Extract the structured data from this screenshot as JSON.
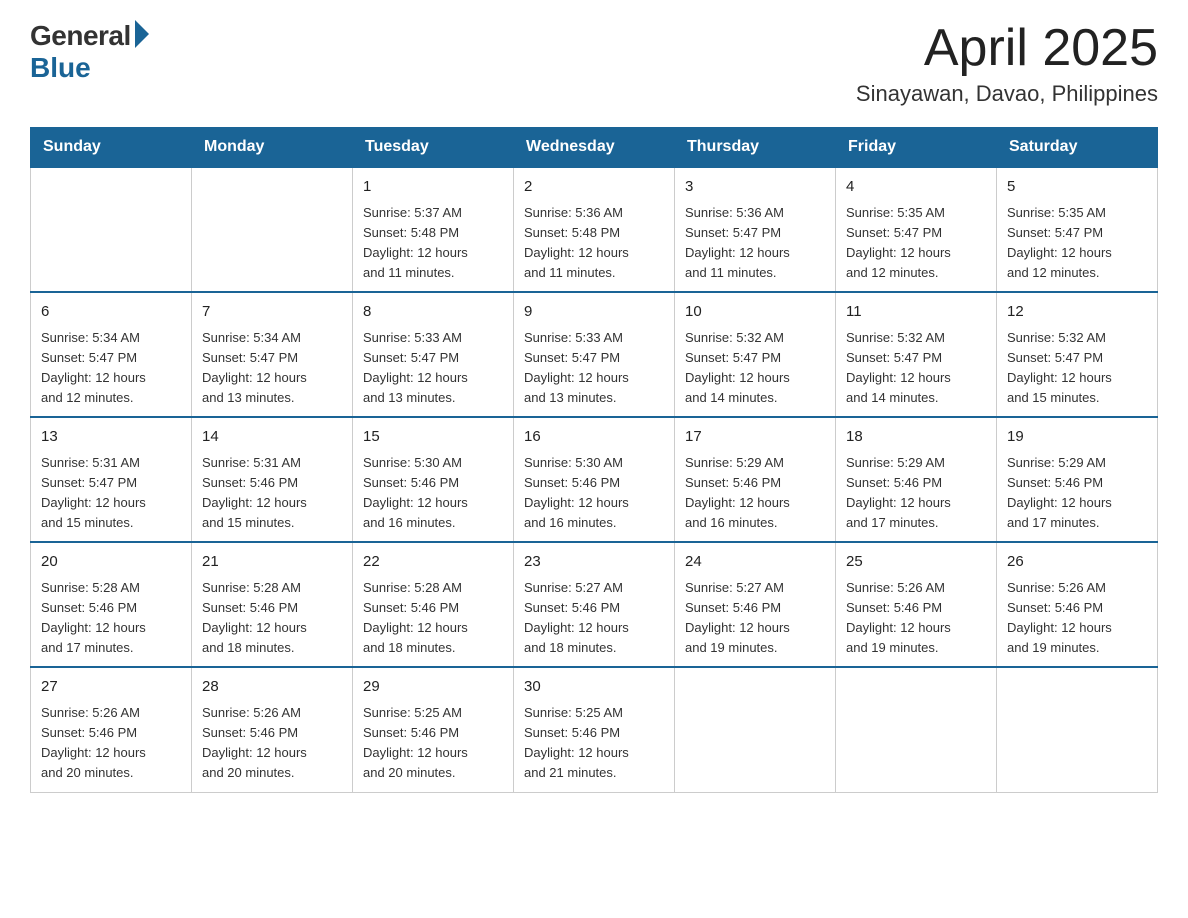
{
  "logo": {
    "general": "General",
    "blue": "Blue"
  },
  "title": {
    "month_year": "April 2025",
    "location": "Sinayawan, Davao, Philippines"
  },
  "weekdays": [
    "Sunday",
    "Monday",
    "Tuesday",
    "Wednesday",
    "Thursday",
    "Friday",
    "Saturday"
  ],
  "weeks": [
    [
      {
        "day": "",
        "info": ""
      },
      {
        "day": "",
        "info": ""
      },
      {
        "day": "1",
        "info": "Sunrise: 5:37 AM\nSunset: 5:48 PM\nDaylight: 12 hours\nand 11 minutes."
      },
      {
        "day": "2",
        "info": "Sunrise: 5:36 AM\nSunset: 5:48 PM\nDaylight: 12 hours\nand 11 minutes."
      },
      {
        "day": "3",
        "info": "Sunrise: 5:36 AM\nSunset: 5:47 PM\nDaylight: 12 hours\nand 11 minutes."
      },
      {
        "day": "4",
        "info": "Sunrise: 5:35 AM\nSunset: 5:47 PM\nDaylight: 12 hours\nand 12 minutes."
      },
      {
        "day": "5",
        "info": "Sunrise: 5:35 AM\nSunset: 5:47 PM\nDaylight: 12 hours\nand 12 minutes."
      }
    ],
    [
      {
        "day": "6",
        "info": "Sunrise: 5:34 AM\nSunset: 5:47 PM\nDaylight: 12 hours\nand 12 minutes."
      },
      {
        "day": "7",
        "info": "Sunrise: 5:34 AM\nSunset: 5:47 PM\nDaylight: 12 hours\nand 13 minutes."
      },
      {
        "day": "8",
        "info": "Sunrise: 5:33 AM\nSunset: 5:47 PM\nDaylight: 12 hours\nand 13 minutes."
      },
      {
        "day": "9",
        "info": "Sunrise: 5:33 AM\nSunset: 5:47 PM\nDaylight: 12 hours\nand 13 minutes."
      },
      {
        "day": "10",
        "info": "Sunrise: 5:32 AM\nSunset: 5:47 PM\nDaylight: 12 hours\nand 14 minutes."
      },
      {
        "day": "11",
        "info": "Sunrise: 5:32 AM\nSunset: 5:47 PM\nDaylight: 12 hours\nand 14 minutes."
      },
      {
        "day": "12",
        "info": "Sunrise: 5:32 AM\nSunset: 5:47 PM\nDaylight: 12 hours\nand 15 minutes."
      }
    ],
    [
      {
        "day": "13",
        "info": "Sunrise: 5:31 AM\nSunset: 5:47 PM\nDaylight: 12 hours\nand 15 minutes."
      },
      {
        "day": "14",
        "info": "Sunrise: 5:31 AM\nSunset: 5:46 PM\nDaylight: 12 hours\nand 15 minutes."
      },
      {
        "day": "15",
        "info": "Sunrise: 5:30 AM\nSunset: 5:46 PM\nDaylight: 12 hours\nand 16 minutes."
      },
      {
        "day": "16",
        "info": "Sunrise: 5:30 AM\nSunset: 5:46 PM\nDaylight: 12 hours\nand 16 minutes."
      },
      {
        "day": "17",
        "info": "Sunrise: 5:29 AM\nSunset: 5:46 PM\nDaylight: 12 hours\nand 16 minutes."
      },
      {
        "day": "18",
        "info": "Sunrise: 5:29 AM\nSunset: 5:46 PM\nDaylight: 12 hours\nand 17 minutes."
      },
      {
        "day": "19",
        "info": "Sunrise: 5:29 AM\nSunset: 5:46 PM\nDaylight: 12 hours\nand 17 minutes."
      }
    ],
    [
      {
        "day": "20",
        "info": "Sunrise: 5:28 AM\nSunset: 5:46 PM\nDaylight: 12 hours\nand 17 minutes."
      },
      {
        "day": "21",
        "info": "Sunrise: 5:28 AM\nSunset: 5:46 PM\nDaylight: 12 hours\nand 18 minutes."
      },
      {
        "day": "22",
        "info": "Sunrise: 5:28 AM\nSunset: 5:46 PM\nDaylight: 12 hours\nand 18 minutes."
      },
      {
        "day": "23",
        "info": "Sunrise: 5:27 AM\nSunset: 5:46 PM\nDaylight: 12 hours\nand 18 minutes."
      },
      {
        "day": "24",
        "info": "Sunrise: 5:27 AM\nSunset: 5:46 PM\nDaylight: 12 hours\nand 19 minutes."
      },
      {
        "day": "25",
        "info": "Sunrise: 5:26 AM\nSunset: 5:46 PM\nDaylight: 12 hours\nand 19 minutes."
      },
      {
        "day": "26",
        "info": "Sunrise: 5:26 AM\nSunset: 5:46 PM\nDaylight: 12 hours\nand 19 minutes."
      }
    ],
    [
      {
        "day": "27",
        "info": "Sunrise: 5:26 AM\nSunset: 5:46 PM\nDaylight: 12 hours\nand 20 minutes."
      },
      {
        "day": "28",
        "info": "Sunrise: 5:26 AM\nSunset: 5:46 PM\nDaylight: 12 hours\nand 20 minutes."
      },
      {
        "day": "29",
        "info": "Sunrise: 5:25 AM\nSunset: 5:46 PM\nDaylight: 12 hours\nand 20 minutes."
      },
      {
        "day": "30",
        "info": "Sunrise: 5:25 AM\nSunset: 5:46 PM\nDaylight: 12 hours\nand 21 minutes."
      },
      {
        "day": "",
        "info": ""
      },
      {
        "day": "",
        "info": ""
      },
      {
        "day": "",
        "info": ""
      }
    ]
  ]
}
